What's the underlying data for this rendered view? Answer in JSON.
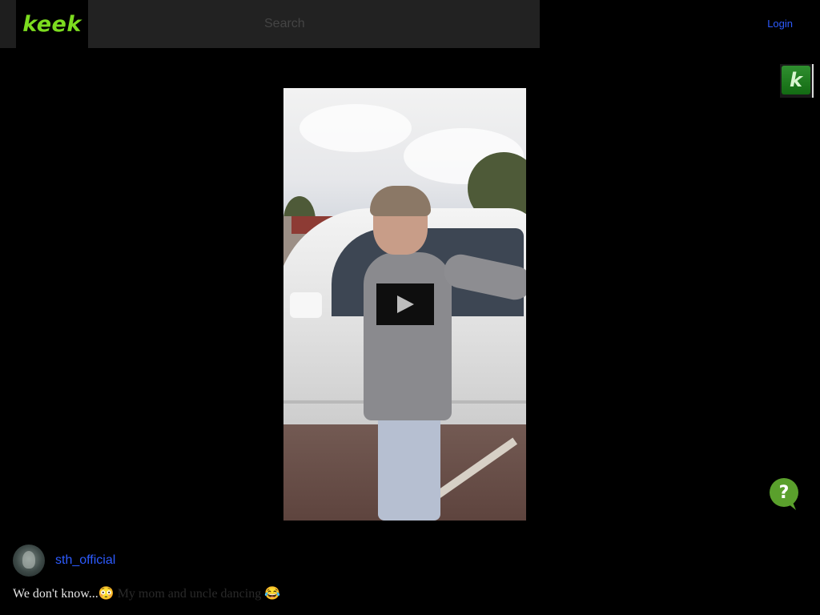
{
  "header": {
    "logo_text": "keek",
    "search_placeholder": "Search",
    "login_label": "Login"
  },
  "badge": {
    "letter": "k"
  },
  "video": {
    "play_icon": "play-icon"
  },
  "post": {
    "username": "sth_official",
    "caption_main": "We don't know...",
    "caption_rest": "😳 My mom and uncle dancing 😂"
  },
  "colors": {
    "background": "#000000",
    "brand_green": "#7cdc1f",
    "link_blue": "#2d5bff",
    "help_green": "#5aa02c"
  }
}
